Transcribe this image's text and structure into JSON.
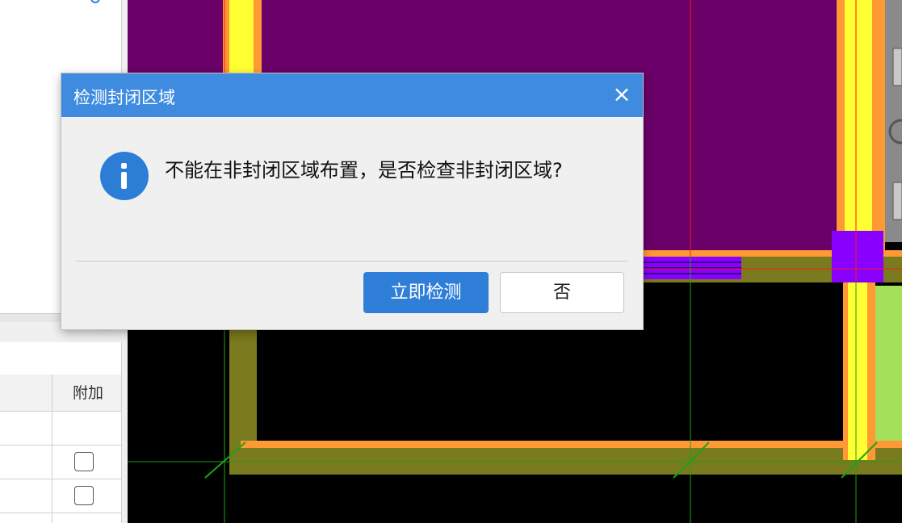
{
  "dialog": {
    "title": "检测封闭区域",
    "close_glyph": "×",
    "message": "不能在非封闭区域布置，是否检查非封闭区域?",
    "confirm_label": "立即检测",
    "cancel_label": "否"
  },
  "left_panel": {
    "close_glyph": "×",
    "table": {
      "header_label": "附加",
      "rows": [
        {
          "checked": false
        },
        {
          "checked": false
        }
      ]
    }
  },
  "colors": {
    "dialog_title_bar": "#3f8be0",
    "primary_button": "#2f7fd9",
    "room_fill": "#6a0068",
    "wall_yellow": "#ffff33",
    "wall_orange": "#ff9933",
    "wall_olive": "#7a7a1e",
    "column_purple": "#8a00ff",
    "green_fill": "#a4e05a",
    "grid_line_red": "#ff1a1a",
    "grid_line_green": "#1aa31a"
  }
}
